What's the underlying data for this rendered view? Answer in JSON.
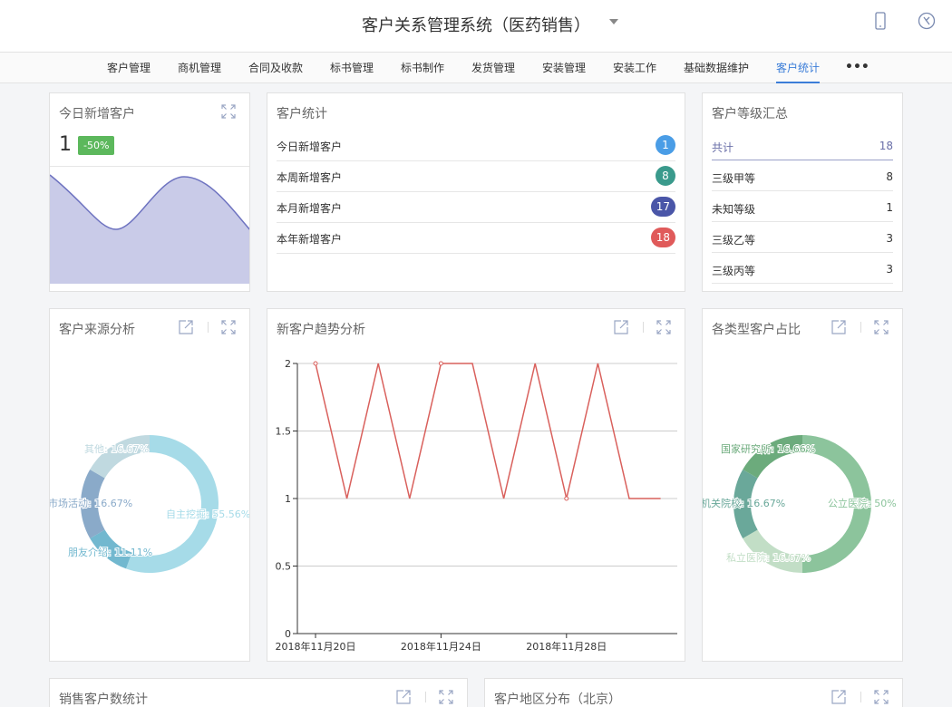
{
  "header": {
    "title": "客户关系管理系统（医药销售）",
    "icons": [
      "mobile-icon",
      "compass-icon"
    ]
  },
  "nav": {
    "items": [
      "客户管理",
      "商机管理",
      "合同及收款",
      "标书管理",
      "标书制作",
      "发货管理",
      "安装管理",
      "安装工作",
      "基础数据维护",
      "客户统计"
    ],
    "active": "客户统计",
    "more": "•••"
  },
  "today_new": {
    "title": "今日新增客户",
    "count": "1",
    "change": "-50%",
    "colors": {
      "line": "#6e73c0",
      "fill": "#c9cbe8",
      "badge": "#5cb85c"
    }
  },
  "customer_stats": {
    "title": "客户统计",
    "rows": [
      {
        "label": "今日新增客户",
        "value": "1",
        "color": "#4a9de6"
      },
      {
        "label": "本周新增客户",
        "value": "8",
        "color": "#3a9a8c"
      },
      {
        "label": "本月新增客户",
        "value": "17",
        "color": "#4a56a8"
      },
      {
        "label": "本年新增客户",
        "value": "18",
        "color": "#e05a5a"
      }
    ]
  },
  "level_summary": {
    "title": "客户等级汇总",
    "total_label": "共计",
    "total_value": "18",
    "rows": [
      {
        "label": "三级甲等",
        "value": "8"
      },
      {
        "label": "未知等级",
        "value": "1"
      },
      {
        "label": "三级乙等",
        "value": "3"
      },
      {
        "label": "三级丙等",
        "value": "3"
      }
    ]
  },
  "source_analysis": {
    "title": "客户来源分析",
    "chart_data": {
      "type": "pie",
      "slices": [
        {
          "label": "自主挖掘: 55.56%",
          "value": 55.56,
          "color": "#a6dbe8"
        },
        {
          "label": "朋友介绍: 11.11%",
          "value": 11.11,
          "color": "#72b8cf"
        },
        {
          "label": "市场活动: 16.67%",
          "value": 16.67,
          "color": "#8aaac9"
        },
        {
          "label": "其他: 16.67%",
          "value": 16.67,
          "color": "#c0d9e0"
        }
      ]
    }
  },
  "trend_analysis": {
    "title": "新客户趋势分析",
    "chart_data": {
      "type": "line",
      "x": [
        "2018年11月20日",
        "2018年11月21日",
        "2018年11月22日",
        "2018年11月23日",
        "2018年11月24日",
        "2018年11月25日",
        "2018年11月26日",
        "2018年11月27日",
        "2018年11月28日",
        "2018年11月29日",
        "2018年11月30日",
        "2018年12月1日"
      ],
      "x_tick_labels": [
        "2018年11月20日",
        "2018年11月24日",
        "2018年11月28日"
      ],
      "y": [
        2,
        1,
        2,
        1,
        2,
        2,
        1,
        2,
        1,
        2,
        1,
        1
      ],
      "y_ticks": [
        "0",
        "0.5",
        "1",
        "1.5",
        "2"
      ],
      "ylim": [
        0,
        2
      ],
      "grid": true,
      "color": "#d9605c"
    }
  },
  "type_ratio": {
    "title": "各类型客户占比",
    "chart_data": {
      "type": "pie",
      "slices": [
        {
          "label": "公立医院: 50%",
          "value": 50,
          "color": "#8cc49c"
        },
        {
          "label": "私立医院: 16.67%",
          "value": 16.67,
          "color": "#c2dec6"
        },
        {
          "label": "机关院校: 16.67%",
          "value": 16.67,
          "color": "#6aa89a"
        },
        {
          "label": "国家研究所: 16.66%",
          "value": 16.66,
          "color": "#6cab7c"
        }
      ]
    }
  },
  "sales_count": {
    "title": "销售客户数统计"
  },
  "region": {
    "title": "客户地区分布（北京）"
  }
}
